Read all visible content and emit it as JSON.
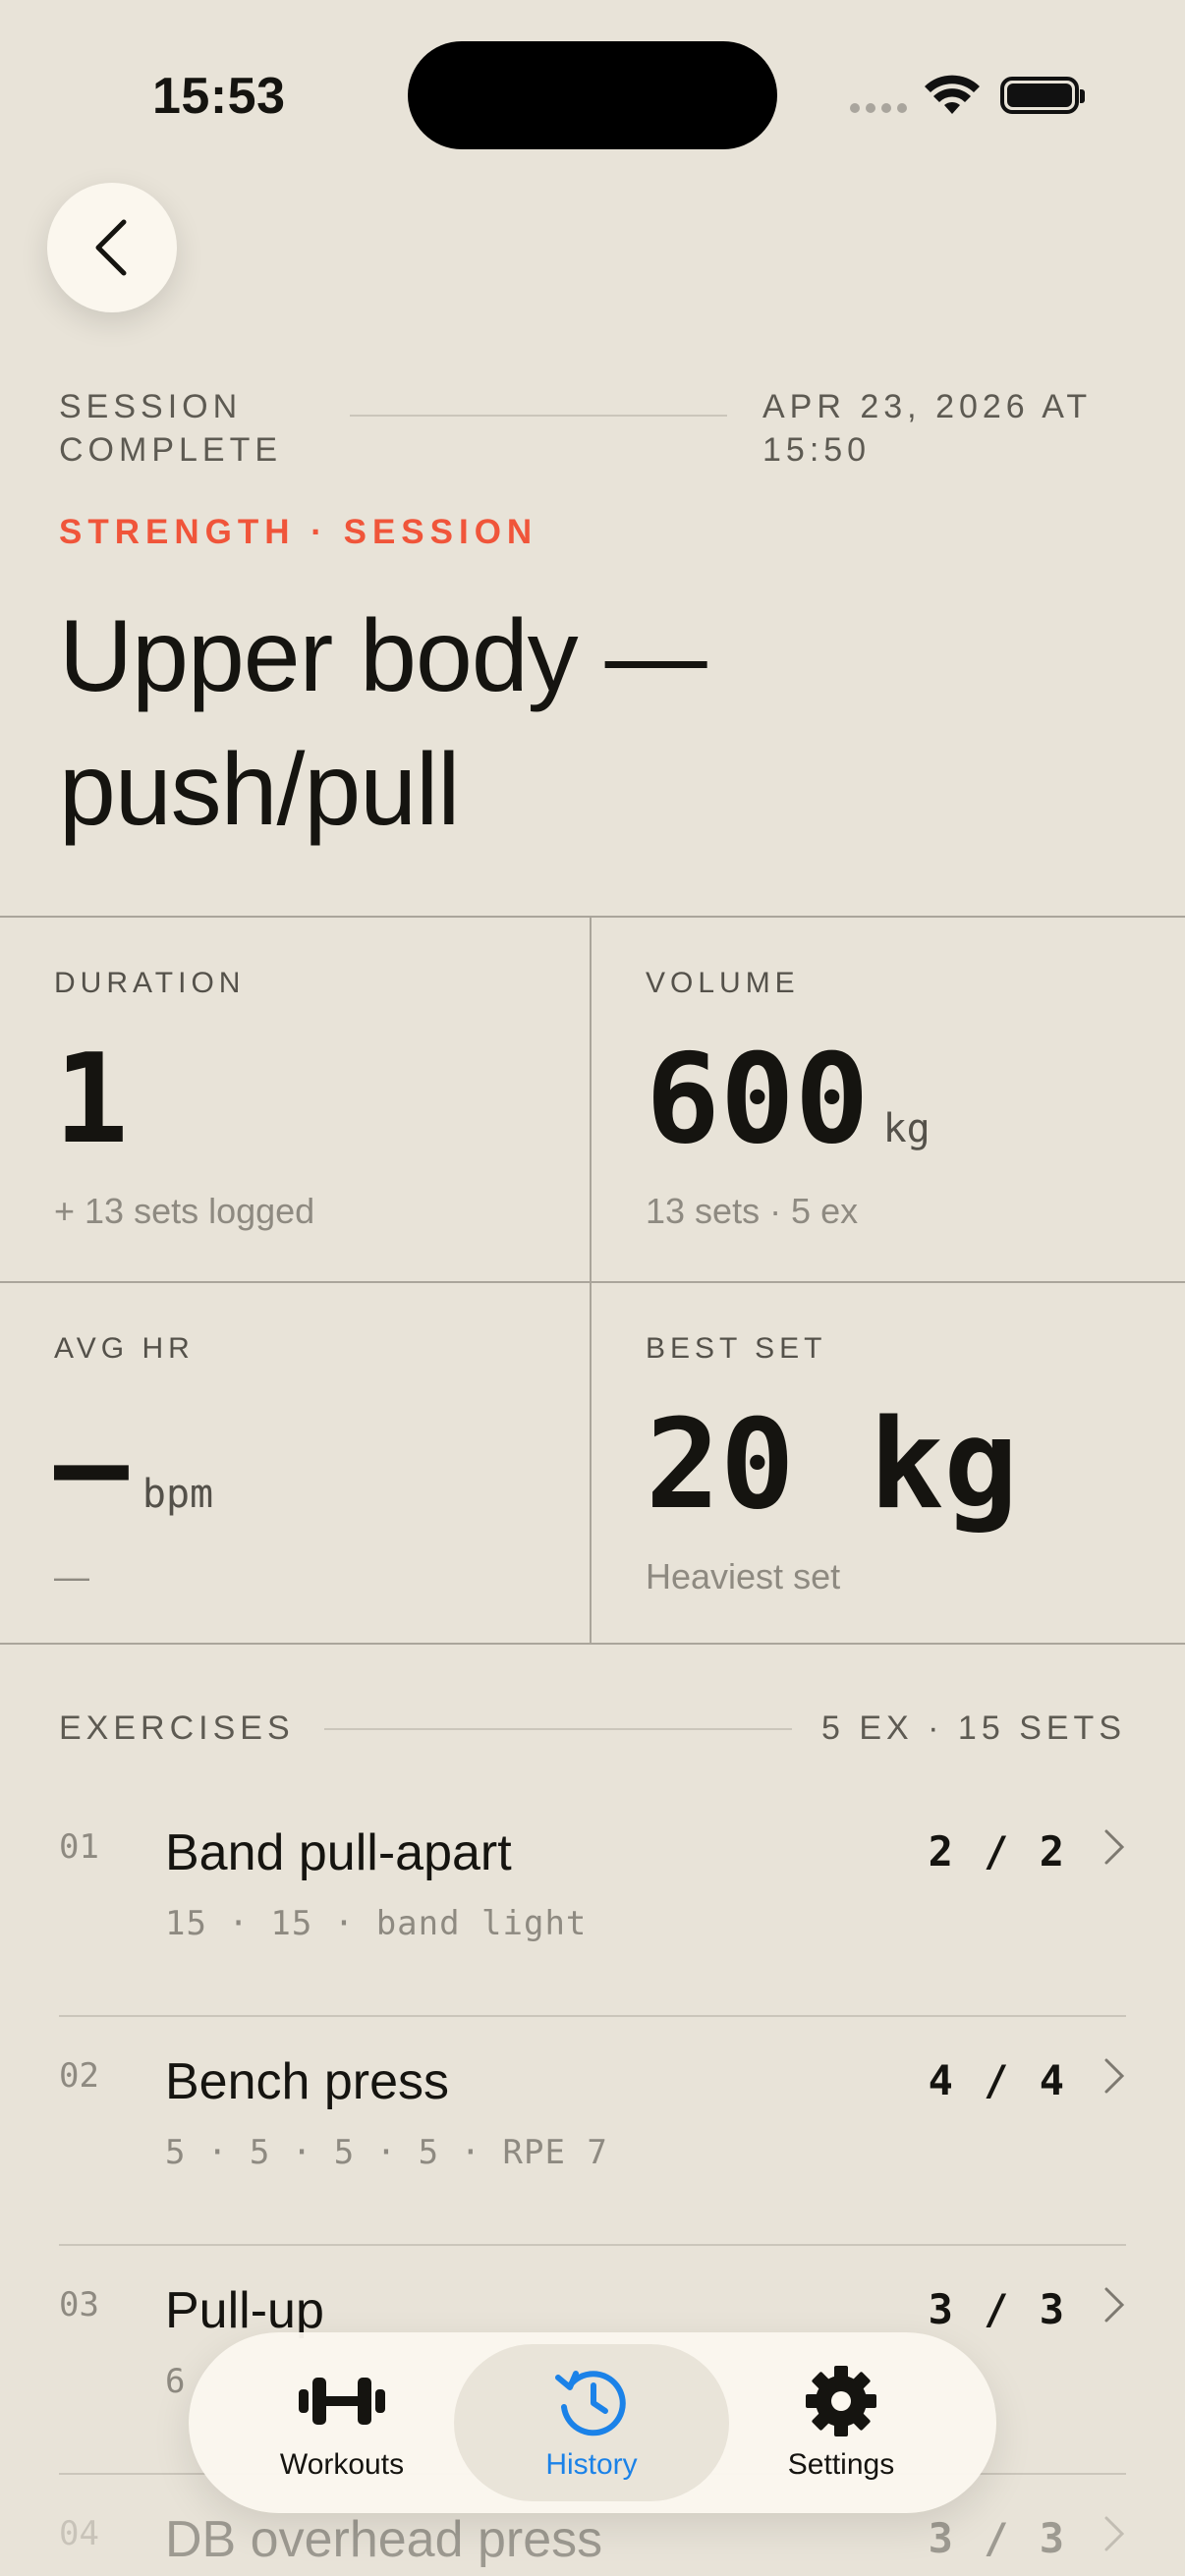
{
  "status_bar": {
    "time": "15:53"
  },
  "header": {
    "eyebrow_left": "SESSION COMPLETE",
    "eyebrow_right": "APR 23, 2026 AT 15:50",
    "category": "STRENGTH · SESSION",
    "title": "Upper body — push/pull"
  },
  "stats": {
    "duration": {
      "label": "DURATION",
      "value": "1",
      "sub": "+ 13 sets logged"
    },
    "volume": {
      "label": "VOLUME",
      "value": "600",
      "unit": "kg",
      "sub": "13 sets · 5 ex"
    },
    "avg_hr": {
      "label": "AVG HR",
      "value": "—",
      "unit": "bpm",
      "sub": "—"
    },
    "best_set": {
      "label": "BEST SET",
      "value": "20 kg",
      "sub": "Heaviest set"
    }
  },
  "exercises": {
    "label": "EXERCISES",
    "summary": "5 EX · 15 SETS",
    "items": [
      {
        "num": "01",
        "name": "Band pull-apart",
        "detail": "15 · 15 · band light",
        "count": "2 / 2"
      },
      {
        "num": "02",
        "name": "Bench press",
        "detail": "5 · 5 · 5 · 5 · RPE 7",
        "count": "4 / 4"
      },
      {
        "num": "03",
        "name": "Pull-up",
        "detail": "6",
        "count": "3 / 3"
      },
      {
        "num": "04",
        "name": "DB overhead press",
        "detail": "",
        "count": "3 / 3"
      }
    ]
  },
  "tabbar": {
    "workouts": "Workouts",
    "history": "History",
    "settings": "Settings",
    "active_color": "#1b82e8"
  },
  "colors": {
    "accent": "#f0553a",
    "background": "#e8e3d8"
  }
}
